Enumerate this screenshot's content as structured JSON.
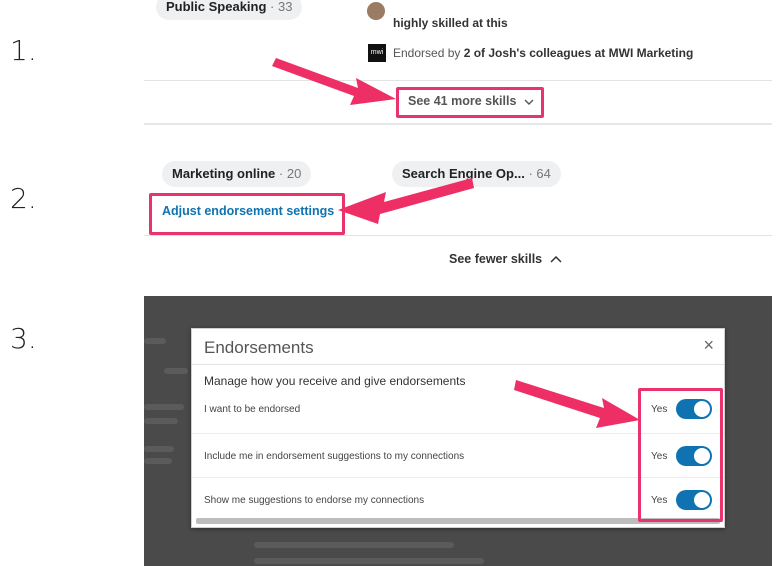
{
  "steps": [
    "1.",
    "2.",
    "3."
  ],
  "section1": {
    "top_pill": {
      "name": "Public Speaking",
      "count": "33"
    },
    "endorser_text": "highly skilled at this",
    "endorsed_by_prefix": "Endorsed by ",
    "endorsed_by_bold": "2 of Josh's colleagues at MWI Marketing",
    "company_logo_text": "mwi",
    "see_more_label": "See 41 more skills"
  },
  "section2": {
    "pills": [
      {
        "name": "Marketing online",
        "count": "20"
      },
      {
        "name": "Search Engine Op...",
        "count": "64"
      }
    ],
    "adjust_link": "Adjust endorsement settings",
    "see_fewer_label": "See fewer skills"
  },
  "section3": {
    "modal_title": "Endorsements",
    "close_glyph": "×",
    "subtitle": "Manage how you receive and give endorsements",
    "rows": [
      {
        "label": "I want to be endorsed",
        "state": "Yes"
      },
      {
        "label": "Include me in endorsement suggestions to my connections",
        "state": "Yes"
      },
      {
        "label": "Show me suggestions to endorse my connections",
        "state": "Yes"
      }
    ]
  },
  "colors": {
    "highlight": "#e8336d",
    "link": "#0e73b0",
    "toggle_on": "#0e73b0"
  }
}
